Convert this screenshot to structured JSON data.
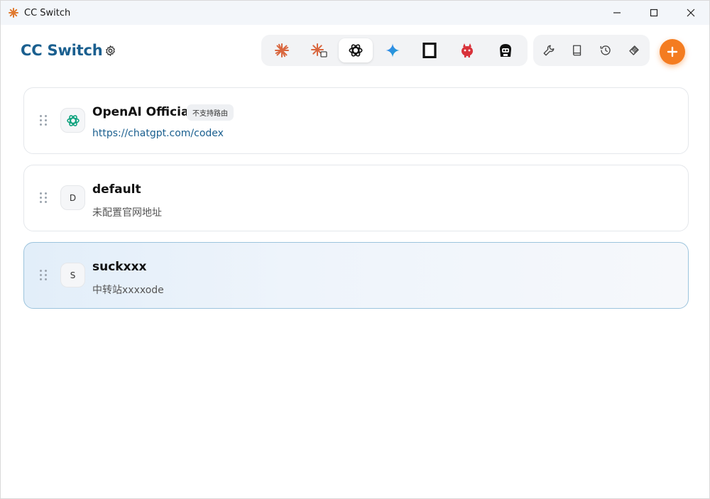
{
  "window": {
    "title": "CC Switch"
  },
  "header": {
    "brand": "CC Switch",
    "apps": [
      {
        "icon": "claude-icon",
        "active": false
      },
      {
        "icon": "claude-desktop-icon",
        "active": false
      },
      {
        "icon": "openai-codex-icon",
        "active": true
      },
      {
        "icon": "gemini-icon",
        "active": false
      },
      {
        "icon": "opencode-icon",
        "active": false
      },
      {
        "icon": "red-mascot-icon",
        "active": false
      },
      {
        "icon": "dark-mascot-icon",
        "active": false
      }
    ],
    "tools": [
      "wrench-icon",
      "book-icon",
      "history-icon",
      "layers-icon"
    ],
    "add_label": "+"
  },
  "providers": [
    {
      "name": "OpenAI Official",
      "subtitle": "https://chatgpt.com/codex",
      "avatar": "",
      "badge": "不支持路由",
      "active": false
    },
    {
      "name": "default",
      "subtitle": "未配置官网地址",
      "avatar": "D",
      "badge": "",
      "active": false
    },
    {
      "name": "suckxxx",
      "subtitle": "中转站xxxxode",
      "avatar": "S",
      "badge": "",
      "active": true
    }
  ],
  "colors": {
    "brand": "#1a5f8f",
    "accent": "#f47c20",
    "active_border": "#9cc4dd",
    "openai_green": "#10a37f"
  }
}
